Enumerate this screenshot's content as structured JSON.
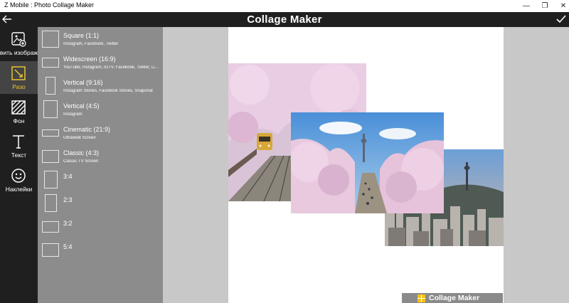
{
  "window": {
    "title": "Z Mobile : Photo Collage Maker",
    "minimize_glyph": "—",
    "maximize_glyph": "❐",
    "close_glyph": "✕"
  },
  "header": {
    "title": "Collage Maker",
    "back_icon": "arrow-left-icon",
    "done_icon": "checkmark-icon"
  },
  "toolbar": {
    "items": [
      {
        "label": "вить изображ",
        "icon": "add-image-icon",
        "active": false
      },
      {
        "label": "Разо",
        "icon": "ratio-icon",
        "active": true
      },
      {
        "label": "Фон",
        "icon": "background-pattern-icon",
        "active": false
      },
      {
        "label": "Текст",
        "icon": "text-icon",
        "active": false
      },
      {
        "label": "Наклейки",
        "icon": "sticker-smiley-icon",
        "active": false
      }
    ],
    "accent_color": "#e8c431"
  },
  "ratios": [
    {
      "name": "Square (1:1)",
      "desc": "Instagram, Facebook, Twitter",
      "aspect": 1.0
    },
    {
      "name": "Widescreen (16:9)",
      "desc": "YouTube, Instagram, IGTV, Facebook, Twitter, LinkedIn",
      "aspect": 1.78
    },
    {
      "name": "Vertical (9:16)",
      "desc": "Instagram Stories, Facebook Stories, Snapchat",
      "aspect": 0.56
    },
    {
      "name": "Vertical (4:5)",
      "desc": "Instagram",
      "aspect": 0.8
    },
    {
      "name": "Cinematic (21:9)",
      "desc": "Ultrawide Screen",
      "aspect": 2.33
    },
    {
      "name": "Classic (4:3)",
      "desc": "Classic TV Screen",
      "aspect": 1.33
    },
    {
      "name": "3:4",
      "desc": "",
      "aspect": 0.75
    },
    {
      "name": "2:3",
      "desc": "",
      "aspect": 0.67
    },
    {
      "name": "3:2",
      "desc": "",
      "aspect": 1.5
    },
    {
      "name": "5:4",
      "desc": "",
      "aspect": 1.25
    }
  ],
  "canvas": {
    "photos": [
      {
        "subject": "cherry blossom railway track"
      },
      {
        "subject": "cherry blossom park with tower"
      },
      {
        "subject": "city skyline at dusk with tower"
      }
    ],
    "watermark": "Collage Maker",
    "watermark_color": "#f4c31b"
  }
}
